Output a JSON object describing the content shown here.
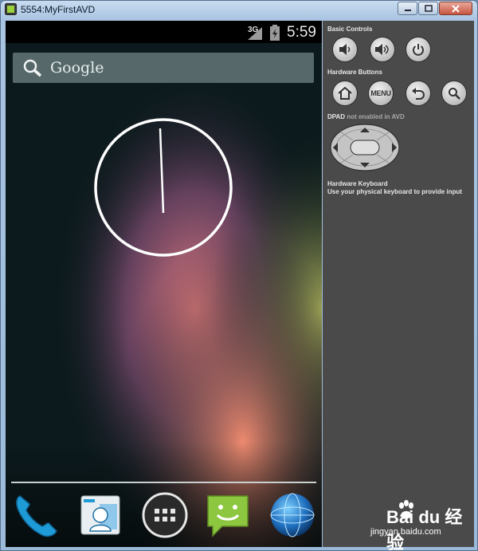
{
  "window": {
    "title": "5554:MyFirstAVD"
  },
  "statusbar": {
    "network": "3G",
    "time": "5:59"
  },
  "search": {
    "label": "Google"
  },
  "panel": {
    "basic_controls": "Basic Controls",
    "hardware_buttons": "Hardware Buttons",
    "menu_button": "MENU",
    "dpad_title": "DPAD",
    "dpad_note": "not enabled in AVD",
    "keyboard_title": "Hardware Keyboard",
    "keyboard_note": "Use your physical keyboard to provide input"
  },
  "dock": {
    "items": [
      "phone",
      "contacts",
      "all-apps",
      "messaging",
      "browser"
    ]
  },
  "watermark": {
    "brand": "Bai du 经验",
    "url": "jingyan.baidu.com"
  },
  "colors": {
    "panel_bg": "#4a4a4a",
    "screen_bg": "#0c1a1d",
    "messaging_green": "#8dc63f",
    "phone_blue": "#1e9bd7"
  }
}
